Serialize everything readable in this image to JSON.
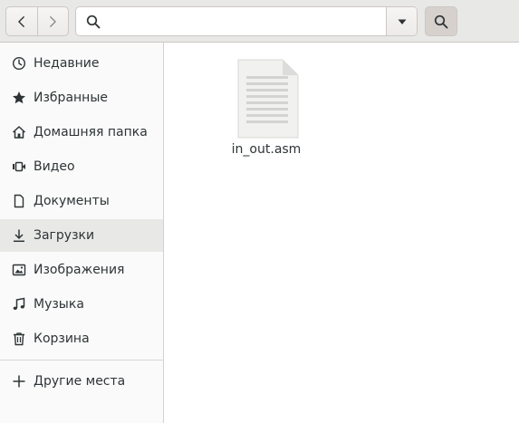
{
  "header": {
    "back_icon": "go-previous-icon",
    "forward_icon": "go-next-icon",
    "location": {
      "value": "",
      "placeholder": ""
    },
    "dropdown_icon": "pan-down-icon",
    "search_icon": "edit-find-icon"
  },
  "sidebar": {
    "items": [
      {
        "label": "Недавние",
        "icon": "recent-icon"
      },
      {
        "label": "Избранные",
        "icon": "starred-icon"
      },
      {
        "label": "Домашняя папка",
        "icon": "home-icon"
      },
      {
        "label": "Видео",
        "icon": "video-icon"
      },
      {
        "label": "Документы",
        "icon": "documents-icon"
      },
      {
        "label": "Загрузки",
        "icon": "downloads-icon",
        "selected": true
      },
      {
        "label": "Изображения",
        "icon": "pictures-icon"
      },
      {
        "label": "Музыка",
        "icon": "music-icon"
      },
      {
        "label": "Корзина",
        "icon": "trash-icon"
      }
    ],
    "other_places": {
      "label": "Другие места",
      "icon": "plus-icon"
    }
  },
  "main": {
    "files": [
      {
        "name": "in_out.asm",
        "icon": "text-file-icon"
      }
    ]
  },
  "colors": {
    "headerbar": "#e8e8e7",
    "sidebar_bg": "#fafafa",
    "selected_row": "#e8e8e7",
    "text": "#2e3436",
    "icon": "#2e3436"
  }
}
